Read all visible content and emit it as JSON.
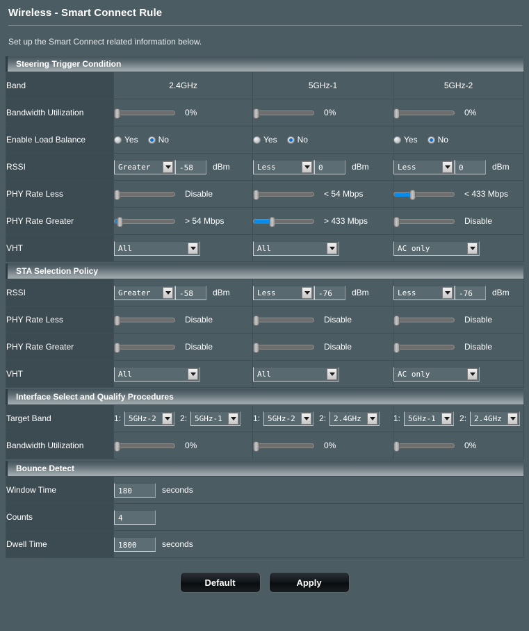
{
  "header": {
    "title": "Wireless - Smart Connect Rule",
    "description": "Set up the Smart Connect related information below."
  },
  "bands": [
    "2.4GHz",
    "5GHz-1",
    "5GHz-2"
  ],
  "labels": {
    "band": "Band",
    "bandwidth_utilization": "Bandwidth Utilization",
    "enable_load_balance": "Enable Load Balance",
    "rssi": "RSSI",
    "phy_rate_less": "PHY Rate Less",
    "phy_rate_greater": "PHY Rate Greater",
    "vht": "VHT",
    "target_band": "Target Band",
    "window_time": "Window Time",
    "counts": "Counts",
    "dwell_time": "Dwell Time"
  },
  "units": {
    "dbm": "dBm",
    "seconds": "seconds",
    "percent_suffix": "%"
  },
  "sections": {
    "steering": {
      "title": "Steering Trigger Condition",
      "bandwidth_utilization": [
        {
          "value": 0,
          "text": "0%"
        },
        {
          "value": 0,
          "text": "0%"
        },
        {
          "value": 0,
          "text": "0%"
        }
      ],
      "load_balance": [
        {
          "yes_label": "Yes",
          "no_label": "No",
          "selected": "No"
        },
        {
          "yes_label": "Yes",
          "no_label": "No",
          "selected": "No"
        },
        {
          "yes_label": "Yes",
          "no_label": "No",
          "selected": "No"
        }
      ],
      "rssi": [
        {
          "compare": "Greater",
          "value": "-58",
          "unit": "dBm"
        },
        {
          "compare": "Less",
          "value": "0",
          "unit": "dBm"
        },
        {
          "compare": "Less",
          "value": "0",
          "unit": "dBm"
        }
      ],
      "phy_rate_less": [
        {
          "fill": 0,
          "pos": 0,
          "text": "Disable"
        },
        {
          "fill": 0,
          "pos": 0,
          "text": "< 54 Mbps"
        },
        {
          "fill": 26,
          "pos": 26,
          "text": "< 433 Mbps"
        }
      ],
      "phy_rate_greater": [
        {
          "fill": 5,
          "pos": 4,
          "text": "> 54 Mbps"
        },
        {
          "fill": 26,
          "pos": 26,
          "text": "> 433 Mbps"
        },
        {
          "fill": 0,
          "pos": 0,
          "text": "Disable"
        }
      ],
      "vht": [
        {
          "value": "All"
        },
        {
          "value": "All"
        },
        {
          "value": "AC only"
        }
      ]
    },
    "sta": {
      "title": "STA Selection Policy",
      "rssi": [
        {
          "compare": "Greater",
          "value": "-58",
          "unit": "dBm"
        },
        {
          "compare": "Less",
          "value": "-76",
          "unit": "dBm"
        },
        {
          "compare": "Less",
          "value": "-76",
          "unit": "dBm"
        }
      ],
      "phy_rate_less": [
        {
          "fill": 0,
          "pos": 0,
          "text": "Disable"
        },
        {
          "fill": 0,
          "pos": 0,
          "text": "Disable"
        },
        {
          "fill": 0,
          "pos": 0,
          "text": "Disable"
        }
      ],
      "phy_rate_greater": [
        {
          "fill": 0,
          "pos": 0,
          "text": "Disable"
        },
        {
          "fill": 0,
          "pos": 0,
          "text": "Disable"
        },
        {
          "fill": 0,
          "pos": 0,
          "text": "Disable"
        }
      ],
      "vht": [
        {
          "value": "All"
        },
        {
          "value": "All"
        },
        {
          "value": "AC only"
        }
      ]
    },
    "interface": {
      "title": "Interface Select and Qualify Procedures",
      "target_band": [
        {
          "p1_label": "1:",
          "p1_value": "5GHz-2",
          "p2_label": "2:",
          "p2_value": "5GHz-1"
        },
        {
          "p1_label": "1:",
          "p1_value": "5GHz-2",
          "p2_label": "2:",
          "p2_value": "2.4GHz"
        },
        {
          "p1_label": "1:",
          "p1_value": "5GHz-1",
          "p2_label": "2:",
          "p2_value": "2.4GHz"
        }
      ],
      "bandwidth_utilization": [
        {
          "value": 0,
          "text": "0%"
        },
        {
          "value": 0,
          "text": "0%"
        },
        {
          "value": 0,
          "text": "0%"
        }
      ]
    },
    "bounce": {
      "title": "Bounce Detect",
      "window_time": {
        "value": "180",
        "unit": "seconds"
      },
      "counts": {
        "value": "4",
        "unit": ""
      },
      "dwell_time": {
        "value": "1800",
        "unit": "seconds"
      }
    }
  },
  "buttons": {
    "default": "Default",
    "apply": "Apply"
  },
  "colors": {
    "page_bg": "#4c5c63",
    "label_bg": "#3c4a51",
    "slider_fill": "#0b8ce8",
    "radio_dot": "#0f6fd0",
    "border": "#3f4d55"
  }
}
